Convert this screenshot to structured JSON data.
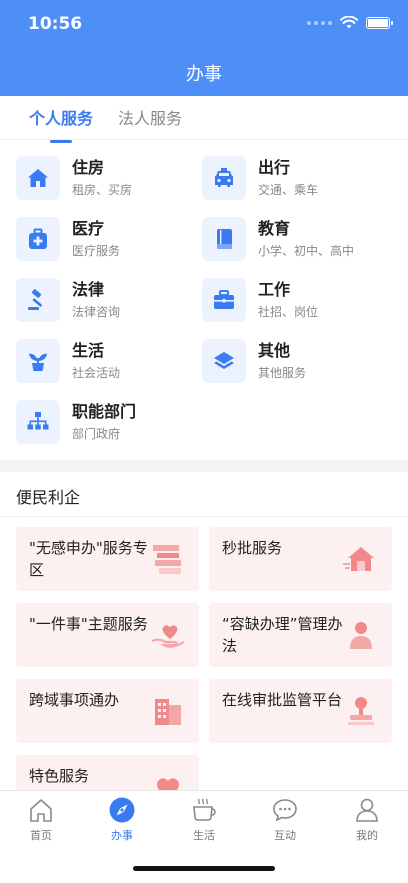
{
  "status_bar": {
    "time": "10:56"
  },
  "header": {
    "title": "办事"
  },
  "tabs": [
    {
      "label": "个人服务"
    },
    {
      "label": "法人服务"
    }
  ],
  "services": [
    {
      "title": "住房",
      "subtitle": "租房、买房",
      "icon": "house-icon"
    },
    {
      "title": "出行",
      "subtitle": "交通、乘车",
      "icon": "car-icon"
    },
    {
      "title": "医疗",
      "subtitle": "医疗服务",
      "icon": "medical-kit-icon"
    },
    {
      "title": "教育",
      "subtitle": "小学、初中、高中",
      "icon": "book-icon"
    },
    {
      "title": "法律",
      "subtitle": "法律咨询",
      "icon": "gavel-icon"
    },
    {
      "title": "工作",
      "subtitle": "社招、岗位",
      "icon": "briefcase-icon"
    },
    {
      "title": "生活",
      "subtitle": "社会活动",
      "icon": "plant-icon"
    },
    {
      "title": "其他",
      "subtitle": "其他服务",
      "icon": "layers-icon"
    },
    {
      "title": "职能部门",
      "subtitle": "部门政府",
      "icon": "org-chart-icon"
    }
  ],
  "convenience": {
    "title": "便民利企",
    "cards": [
      {
        "label": "\"无感申办\"服务专区",
        "icon": "stack-docs-icon"
      },
      {
        "label": "秒批服务",
        "icon": "house-fast-icon"
      },
      {
        "label": "\"一件事\"主题服务",
        "icon": "heart-hand-icon"
      },
      {
        "label": "“容缺办理”管理办法",
        "icon": "person-icon"
      },
      {
        "label": "跨域事项通办",
        "icon": "building-icon"
      },
      {
        "label": "在线审批监管平台",
        "icon": "stamp-person-icon"
      },
      {
        "label": "特色服务",
        "icon": "heart-icon"
      }
    ]
  },
  "tabbar": [
    {
      "label": "首页",
      "icon": "home-icon"
    },
    {
      "label": "办事",
      "icon": "compass-icon"
    },
    {
      "label": "生活",
      "icon": "coffee-cup-icon"
    },
    {
      "label": "互动",
      "icon": "chat-bubble-icon"
    },
    {
      "label": "我的",
      "icon": "user-icon"
    }
  ],
  "colors": {
    "primary": "#4d8ff7",
    "accent": "#3a7bf2",
    "card_bg": "#fdf0f1",
    "icon_bg": "#edf3fe",
    "card_art": "#f08a8a"
  }
}
